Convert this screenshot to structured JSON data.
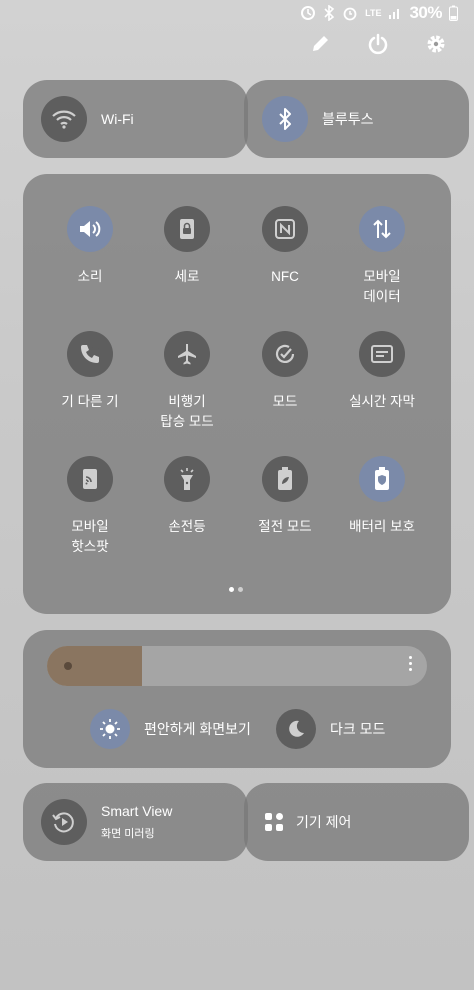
{
  "status_bar": {
    "battery_pct": "30%",
    "network": "LTE"
  },
  "top_actions": {
    "edit_icon": "pencil-icon",
    "power_icon": "power-icon",
    "settings_icon": "gear-icon"
  },
  "wifi": {
    "label": "Wi-Fi",
    "active": false
  },
  "bluetooth": {
    "label": "블루투스",
    "active": true
  },
  "tiles": [
    {
      "label": "소리",
      "icon": "speaker-icon",
      "active": true
    },
    {
      "label": "세로",
      "icon": "lock-rotation-icon",
      "active": false
    },
    {
      "label": "NFC",
      "icon": "nfc-icon",
      "active": false
    },
    {
      "label": "모바일\n데이터",
      "icon": "data-arrows-icon",
      "active": true
    },
    {
      "label": "기    다른 기",
      "icon": "call-sync-icon",
      "active": false
    },
    {
      "label": "비행기\n탑승 모드",
      "icon": "airplane-icon",
      "active": false
    },
    {
      "label": "모드",
      "icon": "mode-check-icon",
      "active": false
    },
    {
      "label": "실시간 자막",
      "icon": "caption-icon",
      "active": false
    },
    {
      "label": "모바일\n핫스팟",
      "icon": "hotspot-icon",
      "active": false
    },
    {
      "label": "손전등",
      "icon": "flashlight-icon",
      "active": false
    },
    {
      "label": "절전 모드",
      "icon": "power-saving-icon",
      "active": false
    },
    {
      "label": "배터리 보호",
      "icon": "battery-protect-icon",
      "active": true
    }
  ],
  "pager": {
    "pages": 2,
    "current": 1
  },
  "brightness": {
    "level": 0.25
  },
  "eye_comfort": {
    "label": "편안하게 화면보기",
    "active": true
  },
  "dark_mode": {
    "label": "다크 모드",
    "active": false
  },
  "smart_view": {
    "title": "Smart View",
    "subtitle": "화면 미러링"
  },
  "device_control": {
    "label": "기기 제어"
  },
  "colors": {
    "active_circle": "#7b8aa9",
    "inactive_circle": "#5e5e5e",
    "panel": "#787878",
    "brightness_fill": "#8a7560"
  }
}
